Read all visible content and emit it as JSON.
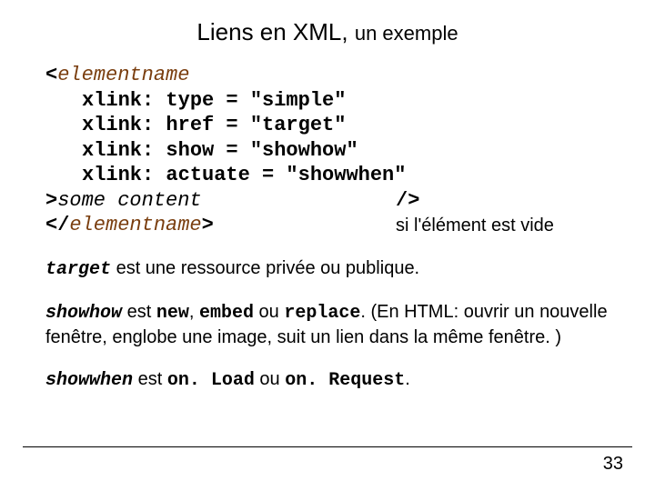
{
  "title": {
    "main": "Liens en XML, ",
    "sub": "un exemple"
  },
  "code": {
    "open_bracket": "<",
    "element": "elementname",
    "attr1": "xlink: type = \"simple\"",
    "attr2": "xlink: href = \"target\"",
    "attr3": "xlink: show = \"showhow\"",
    "attr4": "xlink: actuate = \"showwhen\"",
    "close_bracket": ">",
    "content": "some content",
    "close_open": "</",
    "close_element": "elementname",
    "close_end": ">",
    "self_close": "/>",
    "empty_note": "si l'élément est vide"
  },
  "para1": {
    "code1": "target",
    "text1": "  est une ressource privée ou publique."
  },
  "para2": {
    "code1": "showhow",
    "text1": "  est ",
    "code2": "new",
    "text2": ", ",
    "code3": "embed",
    "text3": " ou ",
    "code4": "replace",
    "text4": ". (En HTML: ouvrir un nouvelle fenêtre, englobe une image, suit un lien dans la même fenêtre. )"
  },
  "para3": {
    "code1": "showwhen",
    "text1": " est ",
    "code2": "on. Load",
    "text2": " ou ",
    "code3": "on. Request",
    "text3": "."
  },
  "page": "33"
}
